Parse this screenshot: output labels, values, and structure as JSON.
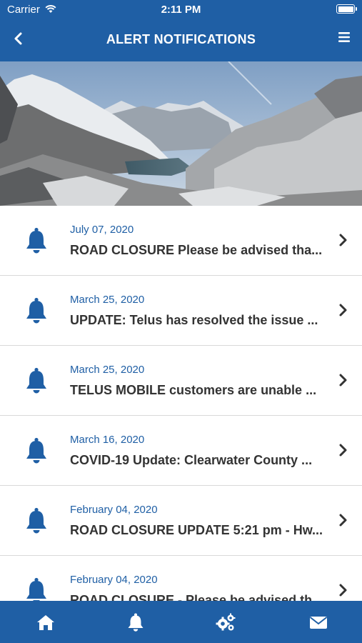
{
  "status_bar": {
    "carrier": "Carrier",
    "time": "2:11 PM"
  },
  "nav": {
    "title": "ALERT NOTIFICATIONS",
    "back_icon": "chevron-left-icon",
    "menu_icon": "hamburger-menu-icon"
  },
  "hero": {
    "description_icon": "mountain-landscape-photo"
  },
  "alerts": [
    {
      "date": "July 07, 2020",
      "message": "ROAD CLOSURE Please be advised tha..."
    },
    {
      "date": "March 25, 2020",
      "message": "UPDATE: Telus has resolved the issue ..."
    },
    {
      "date": "March 25, 2020",
      "message": "TELUS MOBILE customers are unable ..."
    },
    {
      "date": "March 16, 2020",
      "message": "COVID-19 Update: Clearwater County ..."
    },
    {
      "date": "February 04, 2020",
      "message": "ROAD CLOSURE UPDATE 5:21 pm - Hw..."
    },
    {
      "date": "February 04, 2020",
      "message": "ROAD CLOSURE - Please be advised th..."
    }
  ],
  "tabs": [
    {
      "icon": "home-icon"
    },
    {
      "icon": "bell-icon"
    },
    {
      "icon": "gears-icon"
    },
    {
      "icon": "envelope-icon"
    }
  ],
  "colors": {
    "brand_blue": "#1f5fa5",
    "date_blue": "#1f5fa5",
    "message_text": "#333333",
    "divider": "#d9d9d9"
  }
}
